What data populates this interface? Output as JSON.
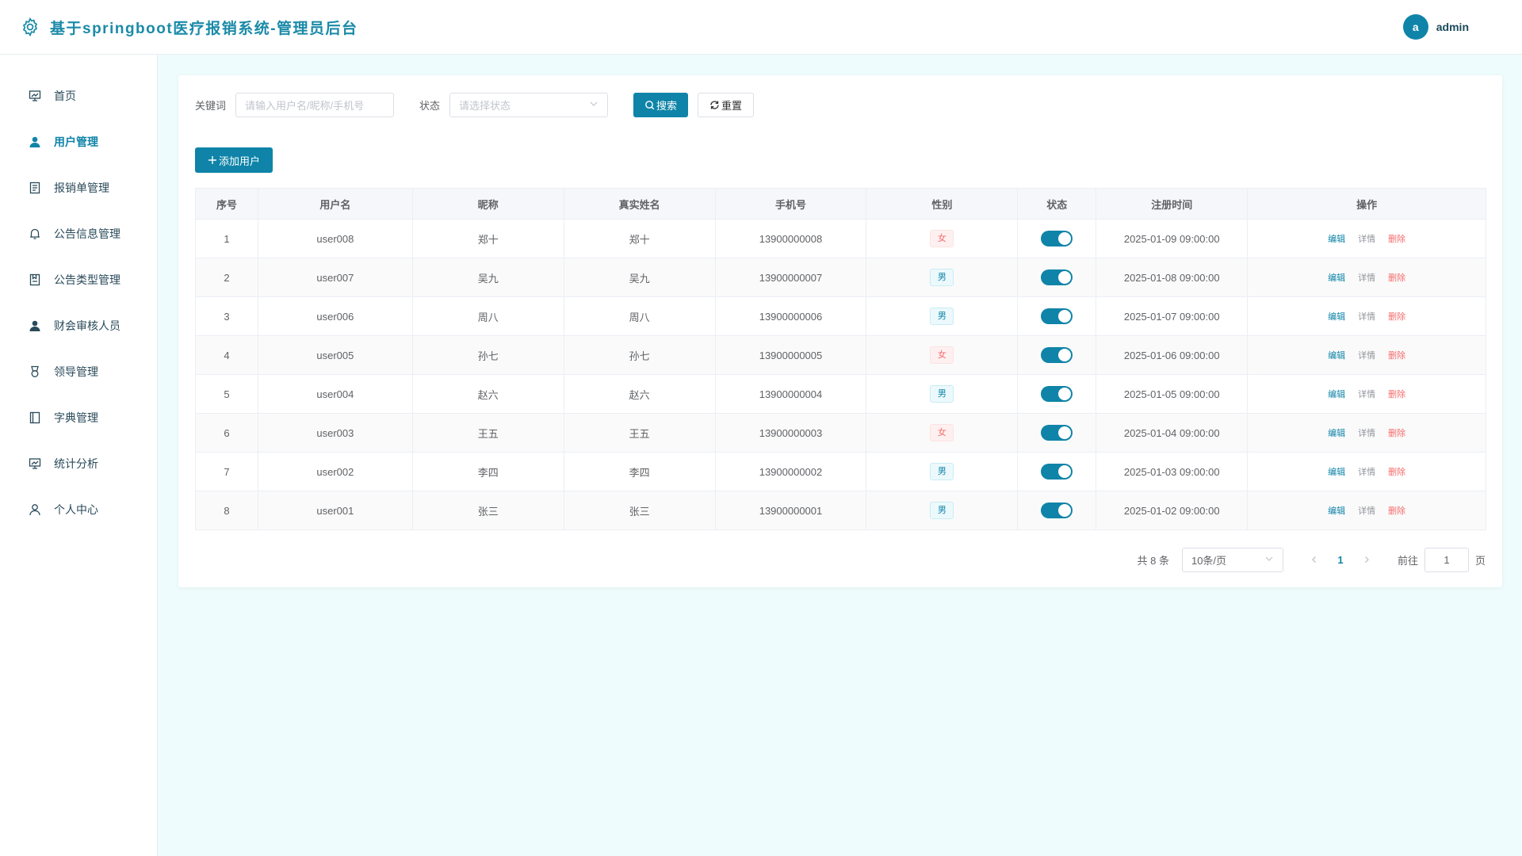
{
  "header": {
    "title": "基于springboot医疗报销系统-管理员后台",
    "avatar_letter": "a",
    "username": "admin",
    "logo_icon": "gear-icon"
  },
  "sidebar": {
    "items": [
      {
        "label": "首页",
        "icon": "dashboard-icon",
        "active": false
      },
      {
        "label": "用户管理",
        "icon": "user-icon",
        "active": true
      },
      {
        "label": "报销单管理",
        "icon": "document-icon",
        "active": false
      },
      {
        "label": "公告信息管理",
        "icon": "bell-icon",
        "active": false
      },
      {
        "label": "公告类型管理",
        "icon": "bookmark-icon",
        "active": false
      },
      {
        "label": "财会审核人员",
        "icon": "user-icon",
        "active": false
      },
      {
        "label": "领导管理",
        "icon": "medal-icon",
        "active": false
      },
      {
        "label": "字典管理",
        "icon": "book-icon",
        "active": false
      },
      {
        "label": "统计分析",
        "icon": "chart-icon",
        "active": false
      },
      {
        "label": "个人中心",
        "icon": "person-icon",
        "active": false
      }
    ]
  },
  "search": {
    "keyword_label": "关键词",
    "keyword_placeholder": "请输入用户名/昵称/手机号",
    "status_label": "状态",
    "status_placeholder": "请选择状态",
    "search_button": "搜索",
    "reset_button": "重置"
  },
  "add_button": "添加用户",
  "table": {
    "columns": [
      "序号",
      "用户名",
      "昵称",
      "真实姓名",
      "手机号",
      "性别",
      "状态",
      "注册时间",
      "操作"
    ],
    "actions": {
      "edit": "编辑",
      "detail": "详情",
      "delete": "删除"
    },
    "rows": [
      {
        "index": "1",
        "username": "user008",
        "nickname": "郑十",
        "realname": "郑十",
        "phone": "13900000008",
        "gender": "女",
        "enabled": true,
        "created": "2025-01-09 09:00:00"
      },
      {
        "index": "2",
        "username": "user007",
        "nickname": "吴九",
        "realname": "吴九",
        "phone": "13900000007",
        "gender": "男",
        "enabled": true,
        "created": "2025-01-08 09:00:00"
      },
      {
        "index": "3",
        "username": "user006",
        "nickname": "周八",
        "realname": "周八",
        "phone": "13900000006",
        "gender": "男",
        "enabled": true,
        "created": "2025-01-07 09:00:00"
      },
      {
        "index": "4",
        "username": "user005",
        "nickname": "孙七",
        "realname": "孙七",
        "phone": "13900000005",
        "gender": "女",
        "enabled": true,
        "created": "2025-01-06 09:00:00"
      },
      {
        "index": "5",
        "username": "user004",
        "nickname": "赵六",
        "realname": "赵六",
        "phone": "13900000004",
        "gender": "男",
        "enabled": true,
        "created": "2025-01-05 09:00:00"
      },
      {
        "index": "6",
        "username": "user003",
        "nickname": "王五",
        "realname": "王五",
        "phone": "13900000003",
        "gender": "女",
        "enabled": true,
        "created": "2025-01-04 09:00:00"
      },
      {
        "index": "7",
        "username": "user002",
        "nickname": "李四",
        "realname": "李四",
        "phone": "13900000002",
        "gender": "男",
        "enabled": true,
        "created": "2025-01-03 09:00:00"
      },
      {
        "index": "8",
        "username": "user001",
        "nickname": "张三",
        "realname": "张三",
        "phone": "13900000001",
        "gender": "男",
        "enabled": true,
        "created": "2025-01-02 09:00:00"
      }
    ]
  },
  "pagination": {
    "total_text": "共 8 条",
    "page_size": "10条/页",
    "current_page": "1",
    "goto_label": "前往",
    "goto_value": "1",
    "page_suffix": "页"
  },
  "colors": {
    "primary": "#0f84a8",
    "danger": "#f56c6c",
    "background": "#eefcfd"
  }
}
